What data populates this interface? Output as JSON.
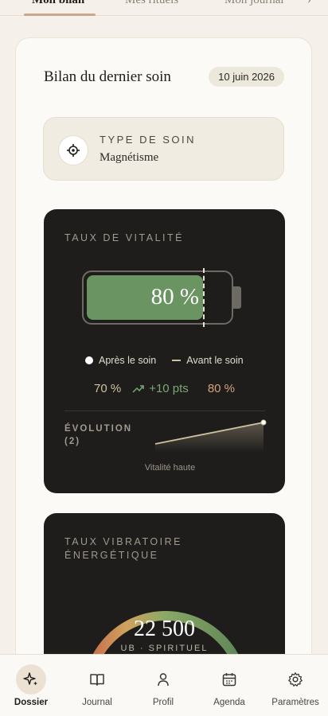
{
  "tabs": [
    "Mon bilan",
    "Mes rituels",
    "Mon journal"
  ],
  "card": {
    "title": "Bilan du dernier soin",
    "date": "10 juin 2026"
  },
  "type_soin": {
    "label": "TYPE DE SOIN",
    "value": "Magnétisme",
    "icon": "target-icon"
  },
  "vitalite": {
    "label": "TAUX DE VITALITÉ",
    "display": "80 %",
    "level_after": 0.8,
    "level_before": 0.8,
    "legend_after": "Après le soin",
    "legend_before": "Avant le soin",
    "after_value": "70 %",
    "delta": "+10 pts",
    "before_value": "80 %",
    "evolution_label_1": "ÉVOLUTION",
    "evolution_label_2": "(2)",
    "evolution_caption": "Vitalité haute",
    "colors": {
      "fill": "#6b9463",
      "delta": "#7aa874",
      "before": "#d9a07e"
    }
  },
  "vibratoire": {
    "label_1": "TAUX VIBRATOIRE",
    "label_2": "ÉNERGÉTIQUE",
    "value": "22 500",
    "unit": "UB · SPIRITUEL"
  },
  "nav": [
    {
      "label": "Dossier",
      "icon": "sparkle-icon",
      "active": true
    },
    {
      "label": "Journal",
      "icon": "book-icon",
      "active": false
    },
    {
      "label": "Profil",
      "icon": "person-icon",
      "active": false
    },
    {
      "label": "Agenda",
      "icon": "calendar-icon",
      "active": false
    },
    {
      "label": "Paramètres",
      "icon": "gear-icon",
      "active": false
    }
  ]
}
